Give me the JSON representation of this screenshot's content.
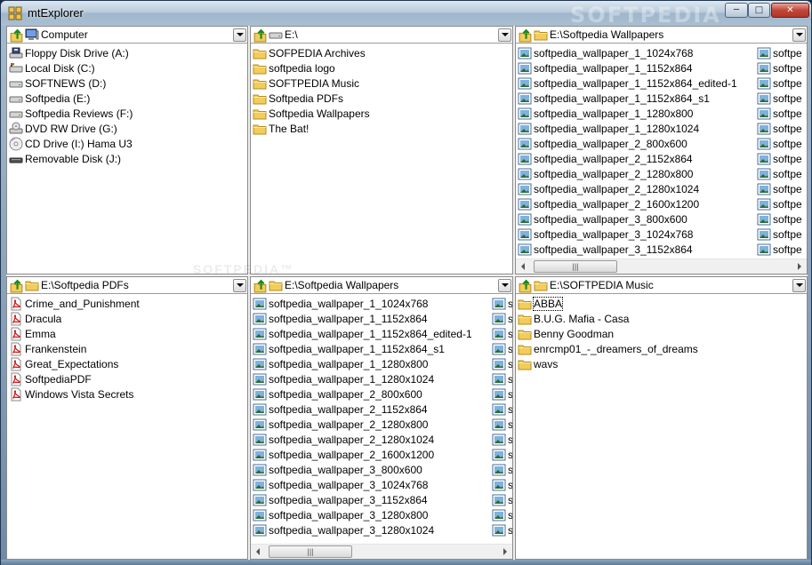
{
  "window": {
    "title": "mtExplorer",
    "watermark": "SOFTPEDIA",
    "controls": {
      "minimize": "─",
      "maximize": "□",
      "close": "✕"
    }
  },
  "center_watermark": "SOFTPEDIA™",
  "panes": [
    {
      "id": "top-left",
      "path": "Computer",
      "header_icon": "computer-icon",
      "items": [
        {
          "label": "Floppy Disk Drive (A:)",
          "icon": "floppy-icon"
        },
        {
          "label": "Local Disk (C:)",
          "icon": "system-drive-icon"
        },
        {
          "label": "SOFTNEWS (D:)",
          "icon": "drive-icon"
        },
        {
          "label": "Softpedia (E:)",
          "icon": "drive-icon"
        },
        {
          "label": "Softpedia Reviews (F:)",
          "icon": "drive-icon"
        },
        {
          "label": "DVD RW Drive (G:)",
          "icon": "dvd-icon"
        },
        {
          "label": "CD Drive (I:) Hama U3",
          "icon": "cd-icon"
        },
        {
          "label": "Removable Disk (J:)",
          "icon": "removable-icon"
        }
      ]
    },
    {
      "id": "top-middle",
      "path": "E:\\",
      "header_icon": "drive-icon",
      "items": [
        {
          "label": "SOFPEDIA Archives",
          "icon": "folder-icon"
        },
        {
          "label": "softpedia logo",
          "icon": "folder-icon"
        },
        {
          "label": "SOFTPEDIA Music",
          "icon": "folder-icon"
        },
        {
          "label": "Softpedia PDFs",
          "icon": "folder-icon"
        },
        {
          "label": "Softpedia Wallpapers",
          "icon": "folder-icon"
        },
        {
          "label": "The Bat!",
          "icon": "folder-icon"
        }
      ]
    },
    {
      "id": "top-right",
      "path": "E:\\Softpedia Wallpapers",
      "header_icon": "folder-icon",
      "items": [
        {
          "label": "softpedia_wallpaper_1_1024x768",
          "icon": "image-icon"
        },
        {
          "label": "softpedia_wallpaper_1_1152x864",
          "icon": "image-icon"
        },
        {
          "label": "softpedia_wallpaper_1_1152x864_edited-1",
          "icon": "image-icon"
        },
        {
          "label": "softpedia_wallpaper_1_1152x864_s1",
          "icon": "image-icon"
        },
        {
          "label": "softpedia_wallpaper_1_1280x800",
          "icon": "image-icon"
        },
        {
          "label": "softpedia_wallpaper_1_1280x1024",
          "icon": "image-icon"
        },
        {
          "label": "softpedia_wallpaper_2_800x600",
          "icon": "image-icon"
        },
        {
          "label": "softpedia_wallpaper_2_1152x864",
          "icon": "image-icon"
        },
        {
          "label": "softpedia_wallpaper_2_1280x800",
          "icon": "image-icon"
        },
        {
          "label": "softpedia_wallpaper_2_1280x1024",
          "icon": "image-icon"
        },
        {
          "label": "softpedia_wallpaper_2_1600x1200",
          "icon": "image-icon"
        },
        {
          "label": "softpedia_wallpaper_3_800x600",
          "icon": "image-icon"
        },
        {
          "label": "softpedia_wallpaper_3_1024x768",
          "icon": "image-icon"
        },
        {
          "label": "softpedia_wallpaper_3_1152x864",
          "icon": "image-icon"
        }
      ],
      "second_column_items": [
        "softpe",
        "softpe",
        "softpe",
        "softpe",
        "softpe",
        "softpe",
        "softpe",
        "softpe",
        "softpe",
        "softpe",
        "softpe",
        "softpe",
        "softpe",
        "softpe"
      ],
      "scrollbar_thumb": "|||"
    },
    {
      "id": "bottom-left",
      "path": "E:\\Softpedia PDFs",
      "header_icon": "folder-icon",
      "items": [
        {
          "label": "Crime_and_Punishment",
          "icon": "pdf-icon"
        },
        {
          "label": "Dracula",
          "icon": "pdf-icon"
        },
        {
          "label": "Emma",
          "icon": "pdf-icon"
        },
        {
          "label": "Frankenstein",
          "icon": "pdf-icon"
        },
        {
          "label": "Great_Expectations",
          "icon": "pdf-icon"
        },
        {
          "label": "SoftpediaPDF",
          "icon": "pdf-icon"
        },
        {
          "label": "Windows Vista Secrets",
          "icon": "pdf-icon"
        }
      ]
    },
    {
      "id": "bottom-middle",
      "path": "E:\\Softpedia Wallpapers",
      "header_icon": "folder-icon",
      "items": [
        {
          "label": "softpedia_wallpaper_1_1024x768",
          "icon": "image-icon"
        },
        {
          "label": "softpedia_wallpaper_1_1152x864",
          "icon": "image-icon"
        },
        {
          "label": "softpedia_wallpaper_1_1152x864_edited-1",
          "icon": "image-icon"
        },
        {
          "label": "softpedia_wallpaper_1_1152x864_s1",
          "icon": "image-icon"
        },
        {
          "label": "softpedia_wallpaper_1_1280x800",
          "icon": "image-icon"
        },
        {
          "label": "softpedia_wallpaper_1_1280x1024",
          "icon": "image-icon"
        },
        {
          "label": "softpedia_wallpaper_2_800x600",
          "icon": "image-icon"
        },
        {
          "label": "softpedia_wallpaper_2_1152x864",
          "icon": "image-icon"
        },
        {
          "label": "softpedia_wallpaper_2_1280x800",
          "icon": "image-icon"
        },
        {
          "label": "softpedia_wallpaper_2_1280x1024",
          "icon": "image-icon"
        },
        {
          "label": "softpedia_wallpaper_2_1600x1200",
          "icon": "image-icon"
        },
        {
          "label": "softpedia_wallpaper_3_800x600",
          "icon": "image-icon"
        },
        {
          "label": "softpedia_wallpaper_3_1024x768",
          "icon": "image-icon"
        },
        {
          "label": "softpedia_wallpaper_3_1152x864",
          "icon": "image-icon"
        },
        {
          "label": "softpedia_wallpaper_3_1280x800",
          "icon": "image-icon"
        },
        {
          "label": "softpedia_wallpaper_3_1280x1024",
          "icon": "image-icon"
        }
      ],
      "second_column_items": [
        "s",
        "s",
        "s",
        "s",
        "s",
        "s",
        "s",
        "s",
        "s",
        "s",
        "s",
        "s",
        "s",
        "s",
        "s",
        "s"
      ],
      "scrollbar_thumb": "|||"
    },
    {
      "id": "bottom-right",
      "path": "E:\\SOFTPEDIA Music",
      "header_icon": "folder-icon",
      "items": [
        {
          "label": "ABBA",
          "icon": "folder-icon",
          "selected": true
        },
        {
          "label": "B.U.G. Mafia - Casa",
          "icon": "folder-icon"
        },
        {
          "label": "Benny Goodman",
          "icon": "folder-icon"
        },
        {
          "label": "enrcmp01_-_dreamers_of_dreams",
          "icon": "folder-icon"
        },
        {
          "label": "wavs",
          "icon": "folder-icon"
        }
      ]
    }
  ]
}
